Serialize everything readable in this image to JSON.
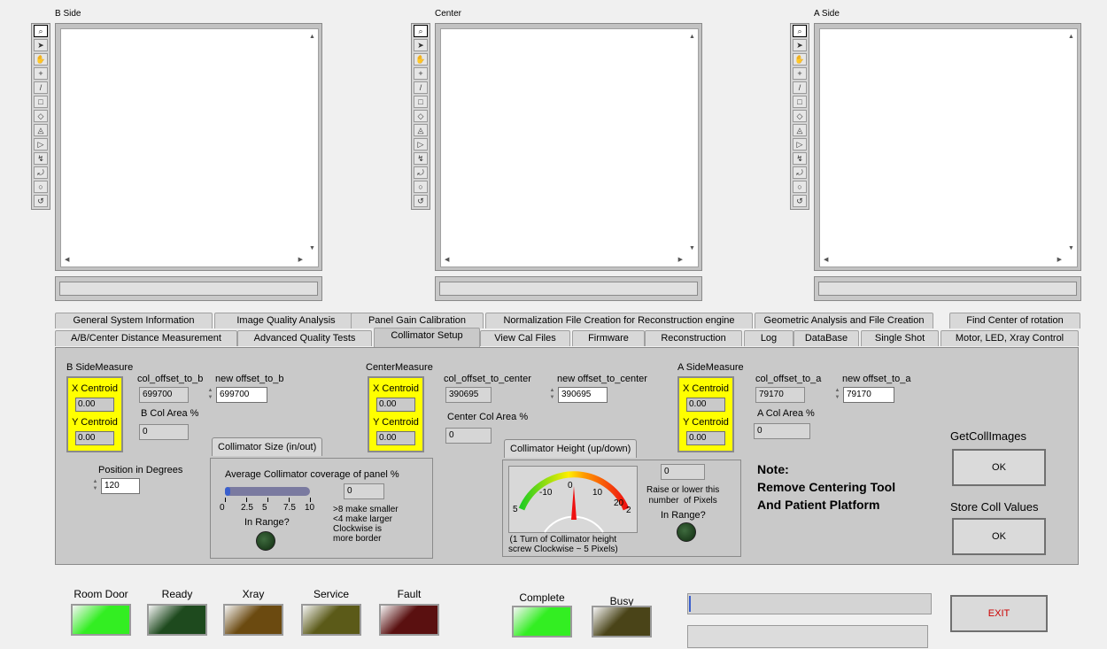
{
  "image_panels": [
    {
      "label": "B Side"
    },
    {
      "label": "Center"
    },
    {
      "label": "A Side"
    }
  ],
  "tools": [
    "magnifier-icon",
    "arrow-icon",
    "hand-icon",
    "crosshair-icon",
    "line-icon",
    "rectangle-icon",
    "rotated-rect-icon",
    "annulus-icon",
    "polygon-icon",
    "freehand-icon",
    "freeline-icon",
    "oval-icon",
    "spiral-icon"
  ],
  "tabs_row1": [
    "General System Information",
    "Image Quality Analysis",
    "Panel Gain Calibration",
    "Normalization File Creation for Reconstruction engine",
    "Geometric Analysis and File Creation",
    "Find Center of rotation"
  ],
  "tabs_row2": [
    "A/B/Center Distance Measurement",
    "Advanced Quality Tests",
    "Collimator Setup",
    "View Cal Files",
    "Firmware",
    "Reconstruction",
    "Log",
    "DataBase",
    "Single Shot",
    "Motor, LED, Xray Control"
  ],
  "bside": {
    "measure_label": "B SideMeasure",
    "x_label": "X Centroid",
    "x_value": "0.00",
    "y_label": "Y Centroid",
    "y_value": "0.00",
    "offset_label": "col_offset_to_b",
    "offset_value": "699700",
    "new_offset_label": "new offset_to_b",
    "new_offset_value": "699700",
    "area_label": "B Col Area %",
    "area_value": "0"
  },
  "center": {
    "measure_label": "CenterMeasure",
    "x_label": "X Centroid",
    "x_value": "0.00",
    "y_label": "Y Centroid",
    "y_value": "0.00",
    "offset_label": "col_offset_to_center",
    "offset_value": "390695",
    "new_offset_label": "new offset_to_center",
    "new_offset_value": "390695",
    "area_label": "Center Col Area %",
    "area_value": "0"
  },
  "aside": {
    "measure_label": "A SideMeasure",
    "x_label": "X Centroid",
    "x_value": "0.00",
    "y_label": "Y Centroid",
    "y_value": "0.00",
    "offset_label": "col_offset_to_a",
    "offset_value": "79170",
    "new_offset_label": "new offset_to_a",
    "new_offset_value": "79170",
    "area_label": "A Col Area %",
    "area_value": "0"
  },
  "position": {
    "label": "Position in Degrees",
    "value": "120"
  },
  "coll_size": {
    "title": "Collimator Size (in/out)",
    "coverage_label": "Average Collimator coverage of panel %",
    "coverage_value": "0",
    "bar_fraction": 0.02,
    "scale_ticks": [
      "0",
      "2.5",
      "5",
      "7.5",
      "10"
    ],
    "in_range_label": "In Range?",
    "hint": ">8 make smaller\n<4 make larger\nClockwise is\nmore border"
  },
  "coll_height": {
    "title": "Collimator Height (up/down)",
    "gauge_ticks": [
      "-10",
      "0",
      "10",
      "20",
      "2"
    ],
    "gauge_left_label": "5",
    "gauge_value": 0,
    "pixels_value": "0",
    "raise_label": "Raise or lower this\nnumber  of Pixels",
    "in_range_label": "In Range?",
    "footnote": "(1 Turn of Collimator height\nscrew Clockwise ~ 5 Pixels)"
  },
  "note": {
    "line1": "Note:",
    "line2": "Remove Centering Tool",
    "line3": "And Patient Platform"
  },
  "get_images": {
    "label": "GetCollImages",
    "button": "OK"
  },
  "store_values": {
    "label": "Store Coll Values",
    "button": "OK"
  },
  "status_leds": [
    {
      "label": "Room Door",
      "color": "#33ee22"
    },
    {
      "label": "Ready",
      "color": "#1e4a1e"
    },
    {
      "label": "Xray",
      "color": "#6b4a10"
    },
    {
      "label": "Service",
      "color": "#5b5a18"
    },
    {
      "label": "Fault",
      "color": "#5a1010"
    }
  ],
  "state_leds": [
    {
      "label": "Complete",
      "color": "#33ee22"
    },
    {
      "label": "Busy",
      "color": "#4a4418"
    }
  ],
  "exit_button": "EXIT",
  "colors": {
    "yellow": "#ffff00",
    "progress_fill": "#3a5fcd",
    "exit_text": "#cc0000"
  }
}
